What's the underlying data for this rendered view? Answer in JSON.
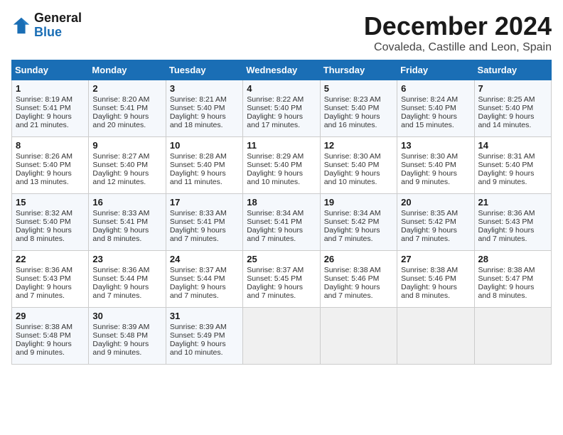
{
  "header": {
    "logo_line1": "General",
    "logo_line2": "Blue",
    "month": "December 2024",
    "location": "Covaleda, Castille and Leon, Spain"
  },
  "days_of_week": [
    "Sunday",
    "Monday",
    "Tuesday",
    "Wednesday",
    "Thursday",
    "Friday",
    "Saturday"
  ],
  "weeks": [
    [
      {
        "day": 1,
        "sunrise": "Sunrise: 8:19 AM",
        "sunset": "Sunset: 5:41 PM",
        "daylight": "Daylight: 9 hours and 21 minutes."
      },
      {
        "day": 2,
        "sunrise": "Sunrise: 8:20 AM",
        "sunset": "Sunset: 5:41 PM",
        "daylight": "Daylight: 9 hours and 20 minutes."
      },
      {
        "day": 3,
        "sunrise": "Sunrise: 8:21 AM",
        "sunset": "Sunset: 5:40 PM",
        "daylight": "Daylight: 9 hours and 18 minutes."
      },
      {
        "day": 4,
        "sunrise": "Sunrise: 8:22 AM",
        "sunset": "Sunset: 5:40 PM",
        "daylight": "Daylight: 9 hours and 17 minutes."
      },
      {
        "day": 5,
        "sunrise": "Sunrise: 8:23 AM",
        "sunset": "Sunset: 5:40 PM",
        "daylight": "Daylight: 9 hours and 16 minutes."
      },
      {
        "day": 6,
        "sunrise": "Sunrise: 8:24 AM",
        "sunset": "Sunset: 5:40 PM",
        "daylight": "Daylight: 9 hours and 15 minutes."
      },
      {
        "day": 7,
        "sunrise": "Sunrise: 8:25 AM",
        "sunset": "Sunset: 5:40 PM",
        "daylight": "Daylight: 9 hours and 14 minutes."
      }
    ],
    [
      {
        "day": 8,
        "sunrise": "Sunrise: 8:26 AM",
        "sunset": "Sunset: 5:40 PM",
        "daylight": "Daylight: 9 hours and 13 minutes."
      },
      {
        "day": 9,
        "sunrise": "Sunrise: 8:27 AM",
        "sunset": "Sunset: 5:40 PM",
        "daylight": "Daylight: 9 hours and 12 minutes."
      },
      {
        "day": 10,
        "sunrise": "Sunrise: 8:28 AM",
        "sunset": "Sunset: 5:40 PM",
        "daylight": "Daylight: 9 hours and 11 minutes."
      },
      {
        "day": 11,
        "sunrise": "Sunrise: 8:29 AM",
        "sunset": "Sunset: 5:40 PM",
        "daylight": "Daylight: 9 hours and 10 minutes."
      },
      {
        "day": 12,
        "sunrise": "Sunrise: 8:30 AM",
        "sunset": "Sunset: 5:40 PM",
        "daylight": "Daylight: 9 hours and 10 minutes."
      },
      {
        "day": 13,
        "sunrise": "Sunrise: 8:30 AM",
        "sunset": "Sunset: 5:40 PM",
        "daylight": "Daylight: 9 hours and 9 minutes."
      },
      {
        "day": 14,
        "sunrise": "Sunrise: 8:31 AM",
        "sunset": "Sunset: 5:40 PM",
        "daylight": "Daylight: 9 hours and 9 minutes."
      }
    ],
    [
      {
        "day": 15,
        "sunrise": "Sunrise: 8:32 AM",
        "sunset": "Sunset: 5:40 PM",
        "daylight": "Daylight: 9 hours and 8 minutes."
      },
      {
        "day": 16,
        "sunrise": "Sunrise: 8:33 AM",
        "sunset": "Sunset: 5:41 PM",
        "daylight": "Daylight: 9 hours and 8 minutes."
      },
      {
        "day": 17,
        "sunrise": "Sunrise: 8:33 AM",
        "sunset": "Sunset: 5:41 PM",
        "daylight": "Daylight: 9 hours and 7 minutes."
      },
      {
        "day": 18,
        "sunrise": "Sunrise: 8:34 AM",
        "sunset": "Sunset: 5:41 PM",
        "daylight": "Daylight: 9 hours and 7 minutes."
      },
      {
        "day": 19,
        "sunrise": "Sunrise: 8:34 AM",
        "sunset": "Sunset: 5:42 PM",
        "daylight": "Daylight: 9 hours and 7 minutes."
      },
      {
        "day": 20,
        "sunrise": "Sunrise: 8:35 AM",
        "sunset": "Sunset: 5:42 PM",
        "daylight": "Daylight: 9 hours and 7 minutes."
      },
      {
        "day": 21,
        "sunrise": "Sunrise: 8:36 AM",
        "sunset": "Sunset: 5:43 PM",
        "daylight": "Daylight: 9 hours and 7 minutes."
      }
    ],
    [
      {
        "day": 22,
        "sunrise": "Sunrise: 8:36 AM",
        "sunset": "Sunset: 5:43 PM",
        "daylight": "Daylight: 9 hours and 7 minutes."
      },
      {
        "day": 23,
        "sunrise": "Sunrise: 8:36 AM",
        "sunset": "Sunset: 5:44 PM",
        "daylight": "Daylight: 9 hours and 7 minutes."
      },
      {
        "day": 24,
        "sunrise": "Sunrise: 8:37 AM",
        "sunset": "Sunset: 5:44 PM",
        "daylight": "Daylight: 9 hours and 7 minutes."
      },
      {
        "day": 25,
        "sunrise": "Sunrise: 8:37 AM",
        "sunset": "Sunset: 5:45 PM",
        "daylight": "Daylight: 9 hours and 7 minutes."
      },
      {
        "day": 26,
        "sunrise": "Sunrise: 8:38 AM",
        "sunset": "Sunset: 5:46 PM",
        "daylight": "Daylight: 9 hours and 7 minutes."
      },
      {
        "day": 27,
        "sunrise": "Sunrise: 8:38 AM",
        "sunset": "Sunset: 5:46 PM",
        "daylight": "Daylight: 9 hours and 8 minutes."
      },
      {
        "day": 28,
        "sunrise": "Sunrise: 8:38 AM",
        "sunset": "Sunset: 5:47 PM",
        "daylight": "Daylight: 9 hours and 8 minutes."
      }
    ],
    [
      {
        "day": 29,
        "sunrise": "Sunrise: 8:38 AM",
        "sunset": "Sunset: 5:48 PM",
        "daylight": "Daylight: 9 hours and 9 minutes."
      },
      {
        "day": 30,
        "sunrise": "Sunrise: 8:39 AM",
        "sunset": "Sunset: 5:48 PM",
        "daylight": "Daylight: 9 hours and 9 minutes."
      },
      {
        "day": 31,
        "sunrise": "Sunrise: 8:39 AM",
        "sunset": "Sunset: 5:49 PM",
        "daylight": "Daylight: 9 hours and 10 minutes."
      },
      null,
      null,
      null,
      null
    ]
  ]
}
